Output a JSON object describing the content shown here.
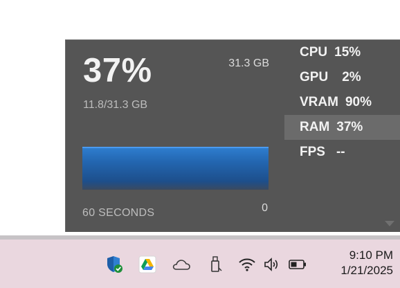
{
  "widget": {
    "percent": "37%",
    "total": "31.3 GB",
    "usage": "11.8/31.3 GB",
    "time_label": "60 SECONDS",
    "min_value": "0",
    "graph_level": 0.37,
    "accent_color": "#2f7fd1",
    "metrics": [
      {
        "name": "CPU",
        "value": "15%"
      },
      {
        "name": "GPU",
        "value": "2%"
      },
      {
        "name": "VRAM",
        "value": "90%"
      },
      {
        "name": "RAM",
        "value": "37%",
        "selected": true
      },
      {
        "name": "FPS",
        "value": "--"
      }
    ]
  },
  "taskbar": {
    "icons": [
      "security-shield-icon",
      "google-drive-icon",
      "onedrive-cloud-icon",
      "usb-drive-icon",
      "wifi-icon",
      "speaker-icon",
      "battery-icon"
    ],
    "time": "9:10 PM",
    "date": "1/21/2025"
  }
}
